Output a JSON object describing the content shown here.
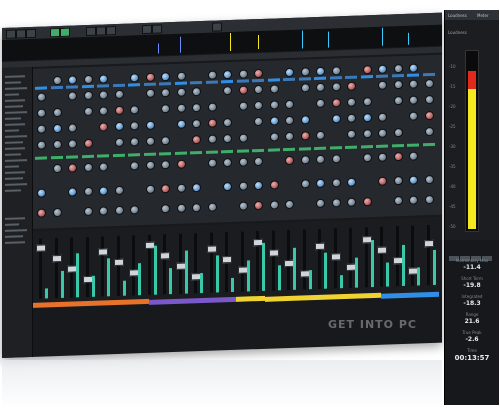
{
  "loudness_panel": {
    "header_left": "Loudness",
    "header_right": "Meter",
    "section": "Loudness",
    "momentary_max_label": "Momentary Max",
    "momentary_max_value": "-11.4",
    "short_term_label": "Short Term",
    "short_term_value": "-19.8",
    "integrated_label": "Integrated",
    "integrated_value": "-18.3",
    "range_label": "Range",
    "range_value": "21.6",
    "true_peak_label": "True Peak",
    "true_peak_value": "-2.6",
    "time_label": "Time",
    "time_value": "00:13:57"
  },
  "meter_scale": [
    "-10",
    "-15",
    "-20",
    "-25",
    "-30",
    "-35",
    "-40",
    "-45",
    "-50"
  ],
  "watermark": "GET INTO PC",
  "colors": {
    "accent_green": "#3fae6a",
    "meter_yellow": "#f4e81e",
    "meter_red": "#e0281c",
    "track_teal": "#39c9a9",
    "strip_orange": "#e8722a",
    "strip_purple": "#7a58c9",
    "strip_yellow": "#f0d330",
    "strip_blue": "#2f8ee6"
  }
}
